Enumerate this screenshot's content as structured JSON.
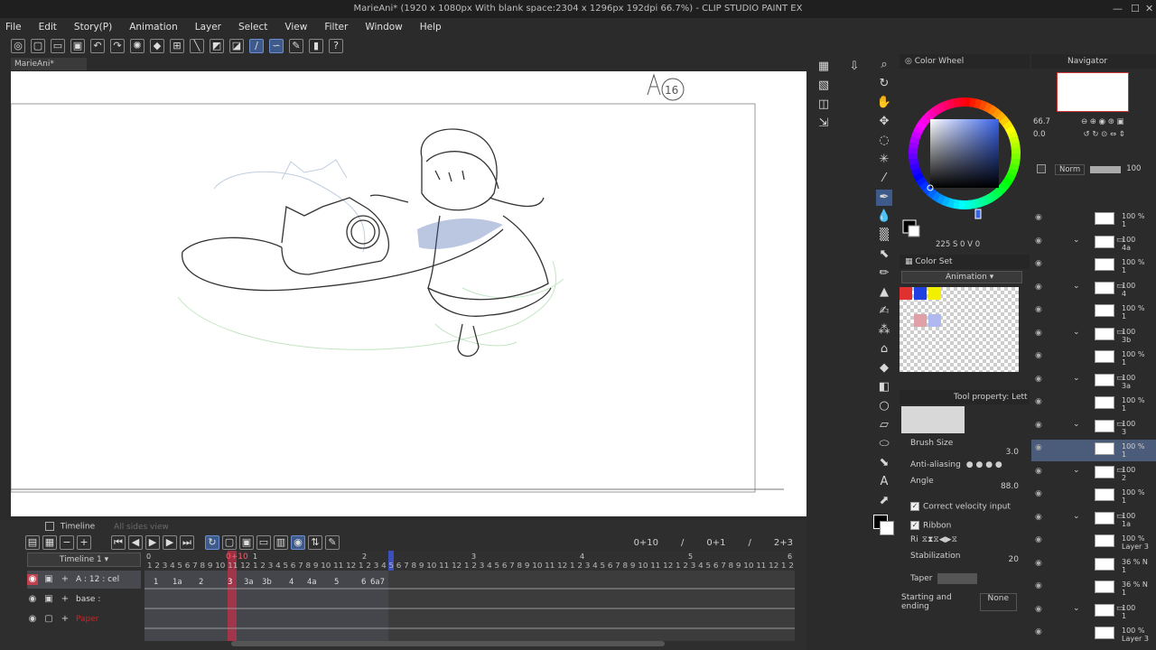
{
  "window": {
    "title": "MarieAni* (1920 x 1080px With blank space:2304 x 1296px 192dpi 66.7%)  - CLIP STUDIO PAINT EX",
    "controls": {
      "minimize": "—",
      "maximize": "☐",
      "close": "✕"
    }
  },
  "menu": [
    "File",
    "Edit",
    "Story(P)",
    "Animation",
    "Layer",
    "Select",
    "View",
    "Filter",
    "Window",
    "Help"
  ],
  "document_tab": "MarieAni*",
  "canvas": {
    "sheet_mark": "A16"
  },
  "timeline": {
    "tab_label": "Timeline",
    "tab2_label": "All sides view",
    "selector": "Timeline 1",
    "frame_start": "0+10",
    "readout_current": "0+10",
    "readout_sep1": "/",
    "readout_mid": "0+1",
    "readout_sep2": "/",
    "readout_end": "2+3",
    "tracks": [
      {
        "name": "A : 12 : cel",
        "color": "#e0e0e0"
      },
      {
        "name": "base :",
        "color": "#e0e0e0"
      },
      {
        "name": "Paper",
        "color": "#d62020"
      }
    ],
    "sec_marks": [
      "0",
      "1",
      "2",
      "3",
      "4",
      "5",
      "6"
    ],
    "ruler_numbers": "1 2 3 4 5 6 7 8 9 10 11 12 1 2 3 4 5 6 7 8 9 10 11 12 1 2 3 4 5 6 7 8 9 10 11 12 1 2 3 4 5 6 7 8 9 10 11 12 1 2 3 4 5 6 7 8 9 10 11 12 1 2 3 4 5 6 7 8 9 10 11 12 1 2",
    "cels": [
      "1",
      "1a",
      "2",
      "3",
      "3a",
      "3b",
      "4",
      "4a",
      "5",
      "6",
      "6a7"
    ]
  },
  "panels": {
    "color_wheel": "Color Wheel",
    "color_values": {
      "h": "225",
      "s_label": "S",
      "s": "0",
      "v_label": "V",
      "v": "0"
    },
    "color_set": "Color Set",
    "color_set_name": "Animation",
    "tool_property": "Tool property: Lett",
    "brush_size_label": "Brush Size",
    "brush_size": "3.0",
    "anti_aliasing_label": "Anti-aliasing",
    "angle_label": "Angle",
    "angle": "88.0",
    "correct_velocity": "Correct velocity input",
    "ribbon": "Ribbon",
    "ribbon_short": "Ri",
    "stabilization_label": "Stabilization",
    "stabilization": "20",
    "taper_label": "Taper",
    "starting_ending_label": "Starting and ending",
    "starting_ending_value": "None",
    "navigator": "Navigator",
    "zoom": "66.7",
    "rotation": "0.0",
    "blend_mode": "Norm",
    "layer_opacity": "100"
  },
  "layers": [
    {
      "pct": "100 %",
      "sub": "1"
    },
    {
      "pct": "100",
      "sub": "4a",
      "folder": true
    },
    {
      "pct": "100 %",
      "sub": "1"
    },
    {
      "pct": "100",
      "sub": "4",
      "folder": true
    },
    {
      "pct": "100 %",
      "sub": "1"
    },
    {
      "pct": "100",
      "sub": "3b",
      "folder": true
    },
    {
      "pct": "100 %",
      "sub": "1"
    },
    {
      "pct": "100",
      "sub": "3a",
      "folder": true
    },
    {
      "pct": "100 %",
      "sub": "1"
    },
    {
      "pct": "100",
      "sub": "3",
      "folder": true
    },
    {
      "pct": "100 %",
      "sub": "1",
      "selected": true
    },
    {
      "pct": "100",
      "sub": "2",
      "folder": true
    },
    {
      "pct": "100 %",
      "sub": "1"
    },
    {
      "pct": "100",
      "sub": "1a",
      "folder": true
    },
    {
      "pct": "100 %",
      "sub": "Layer 3"
    },
    {
      "pct": "36 % N",
      "sub": "1"
    },
    {
      "pct": "36 % N",
      "sub": "1"
    },
    {
      "pct": "100",
      "sub": "1",
      "folder": true
    },
    {
      "pct": "100 %",
      "sub": "Layer 3"
    }
  ],
  "colors": {
    "accent": "#3d5a8a",
    "paper_red": "#d62020",
    "playhead": "#c0304a"
  }
}
